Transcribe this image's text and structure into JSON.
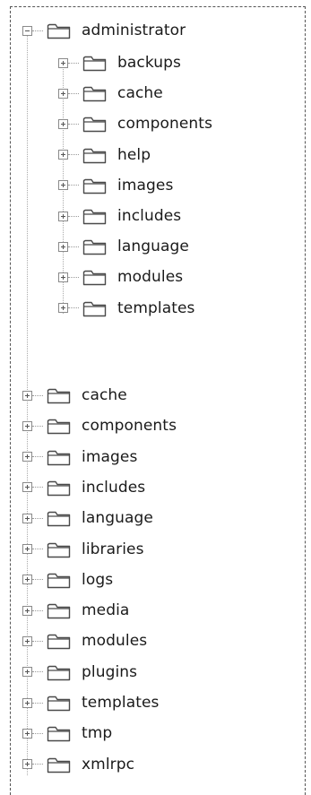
{
  "tree": {
    "root": {
      "label": "administrator",
      "expanded": true,
      "children": [
        {
          "label": "backups"
        },
        {
          "label": "cache"
        },
        {
          "label": "components"
        },
        {
          "label": "help"
        },
        {
          "label": "images"
        },
        {
          "label": "includes"
        },
        {
          "label": "language"
        },
        {
          "label": "modules"
        },
        {
          "label": "templates"
        }
      ]
    },
    "siblings": [
      {
        "label": "cache"
      },
      {
        "label": "components"
      },
      {
        "label": "images"
      },
      {
        "label": "includes"
      },
      {
        "label": "language"
      },
      {
        "label": "libraries"
      },
      {
        "label": "logs"
      },
      {
        "label": "media"
      },
      {
        "label": "modules"
      },
      {
        "label": "plugins"
      },
      {
        "label": "templates"
      },
      {
        "label": "tmp"
      },
      {
        "label": "xmlrpc"
      }
    ]
  }
}
